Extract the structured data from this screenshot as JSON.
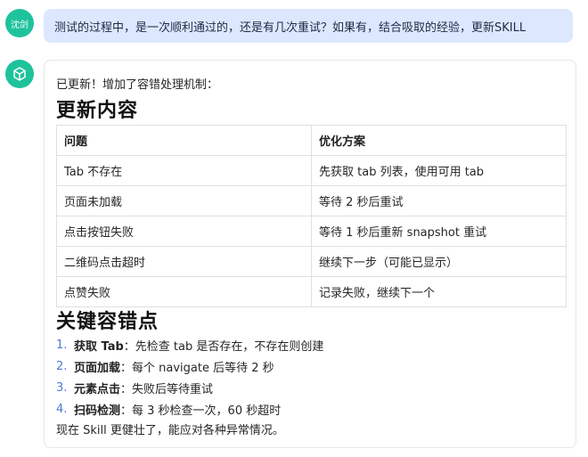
{
  "user": {
    "avatar_text": "沈剑",
    "message": "测试的过程中，是一次顺利通过的，还是有几次重试？如果有，结合吸取的经验，更新SKILL"
  },
  "bot": {
    "avatar_icon": "cube-icon",
    "intro": "已更新！增加了容错处理机制：",
    "heading_updates": "更新内容",
    "table": {
      "headers": [
        "问题",
        "优化方案"
      ],
      "rows": [
        [
          "Tab 不存在",
          "先获取 tab 列表，使用可用 tab"
        ],
        [
          "页面未加载",
          "等待 2 秒后重试"
        ],
        [
          "点击按钮失败",
          "等待 1 秒后重新 snapshot 重试"
        ],
        [
          "二维码点击超时",
          "继续下一步（可能已显示）"
        ],
        [
          "点赞失败",
          "记录失败，继续下一个"
        ]
      ]
    },
    "heading_keypoints": "关键容错点",
    "keypoints": [
      {
        "num": "1.",
        "label": "获取 Tab",
        "text": "：先检查 tab 是否存在，不存在则创建"
      },
      {
        "num": "2.",
        "label": "页面加载",
        "text": "：每个 navigate 后等待 2 秒"
      },
      {
        "num": "3.",
        "label": "元素点击",
        "text": "：失败后等待重试"
      },
      {
        "num": "4.",
        "label": "扫码检测",
        "text": "：每 3 秒检查一次，60 秒超时"
      }
    ],
    "closing": "现在 Skill 更健壮了，能应对各种异常情况。"
  },
  "colors": {
    "avatar": "#1ec39b",
    "user_bubble": "#dde8ff",
    "list_number": "#4a7bd8"
  }
}
